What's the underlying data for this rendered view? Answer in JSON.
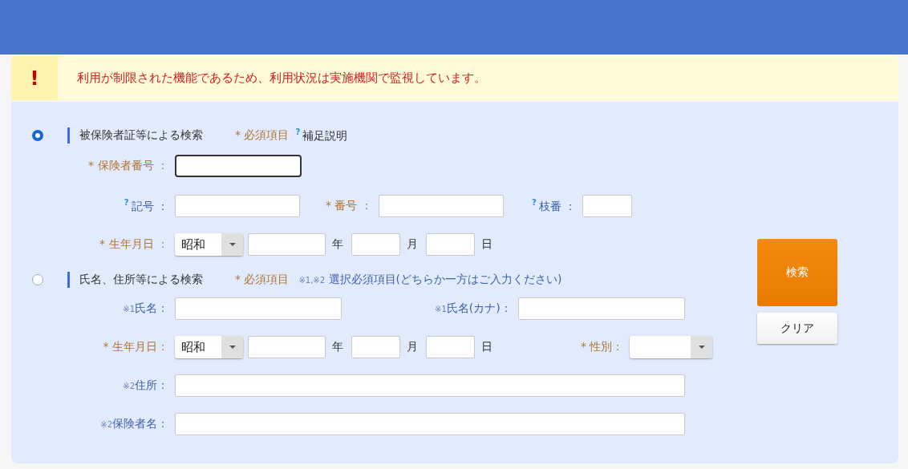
{
  "banner": {
    "icon": "!",
    "message": "利用が制限された機能であるため、利用状況は実施機関で監視しています。"
  },
  "sections": [
    {
      "selected": true,
      "title": "被保険者証等による検索",
      "legend": [
        {
          "kind": "required",
          "mark": "*",
          "text": "必須項目"
        },
        {
          "kind": "help",
          "mark": "?",
          "text": "補足説明"
        }
      ],
      "rows": [
        [
          {
            "kind": "required",
            "mark": "*",
            "text": "保険者番号 ："
          },
          {
            "kind": "input",
            "focused": true
          }
        ],
        [
          {
            "kind": "help",
            "mark": "?",
            "text": "記号 ："
          },
          {
            "kind": "input",
            "focused": false
          },
          {
            "kind": "required",
            "mark": "*",
            "text": "番号 ："
          },
          {
            "kind": "input",
            "focused": false
          },
          {
            "kind": "help",
            "mark": "?",
            "text": "枝番 ："
          },
          {
            "kind": "input",
            "focused": false
          }
        ],
        [
          {
            "kind": "required",
            "mark": "*",
            "text": "生年月日 ："
          },
          {
            "kind": "select",
            "value": "昭和"
          },
          {
            "kind": "input",
            "focused": false
          },
          {
            "kind": "unit",
            "text": "年"
          },
          {
            "kind": "input",
            "focused": false
          },
          {
            "kind": "unit",
            "text": "月"
          },
          {
            "kind": "input",
            "focused": false
          },
          {
            "kind": "unit",
            "text": "日"
          }
        ]
      ]
    },
    {
      "selected": false,
      "title": "氏名、住所等による検索",
      "legend": [
        {
          "kind": "required",
          "mark": "*",
          "text": "必須項目"
        },
        {
          "kind": "note",
          "mark": "※1,※2",
          "text": "選択必須項目(どちらか一方はご入力ください)"
        }
      ],
      "rows": [
        [
          {
            "kind": "note",
            "mark": "※1",
            "text": "氏名："
          },
          {
            "kind": "input",
            "focused": false
          },
          {
            "kind": "note",
            "mark": "※1",
            "text": "氏名(カナ)："
          },
          {
            "kind": "input",
            "focused": false
          }
        ],
        [
          {
            "kind": "required",
            "mark": "*",
            "text": "生年月日："
          },
          {
            "kind": "select",
            "value": "昭和"
          },
          {
            "kind": "input",
            "focused": false
          },
          {
            "kind": "unit",
            "text": "年"
          },
          {
            "kind": "input",
            "focused": false
          },
          {
            "kind": "unit",
            "text": "月"
          },
          {
            "kind": "input",
            "focused": false
          },
          {
            "kind": "unit",
            "text": "日"
          },
          {
            "kind": "required",
            "mark": "*",
            "text": "性別："
          },
          {
            "kind": "select"
          }
        ],
        [
          {
            "kind": "note",
            "mark": "※2",
            "text": "住所："
          },
          {
            "kind": "input",
            "focused": false
          }
        ],
        [
          {
            "kind": "note",
            "mark": "※2",
            "text": "保険者名："
          },
          {
            "kind": "input",
            "focused": false
          }
        ]
      ]
    }
  ],
  "buttons": [
    {
      "kind": "primary",
      "label": "検索"
    },
    {
      "kind": "secondary",
      "label": "クリア"
    }
  ]
}
